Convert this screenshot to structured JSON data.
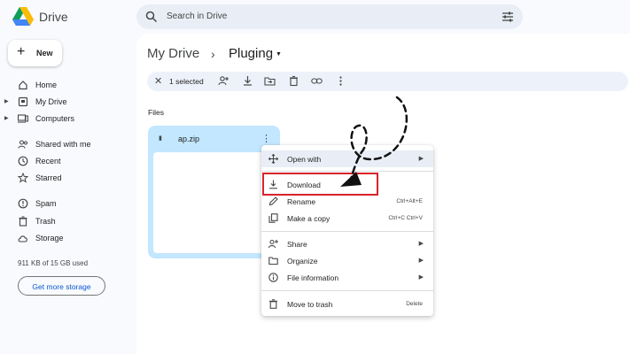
{
  "app": {
    "name": "Drive"
  },
  "search": {
    "placeholder": "Search in Drive"
  },
  "new_button": {
    "label": "New"
  },
  "sidebar": {
    "items": [
      {
        "label": "Home",
        "icon": "home-icon"
      },
      {
        "label": "My Drive",
        "icon": "my-drive-icon"
      },
      {
        "label": "Computers",
        "icon": "computers-icon"
      },
      {
        "label": "Shared with me",
        "icon": "shared-icon"
      },
      {
        "label": "Recent",
        "icon": "clock-icon"
      },
      {
        "label": "Starred",
        "icon": "star-icon"
      },
      {
        "label": "Spam",
        "icon": "spam-icon"
      },
      {
        "label": "Trash",
        "icon": "trash-icon"
      },
      {
        "label": "Storage",
        "icon": "cloud-icon"
      }
    ],
    "storage_text": "911 KB of 15 GB used",
    "storage_button": "Get more storage"
  },
  "breadcrumb": {
    "root": "My Drive",
    "separator": "›",
    "current": "Pluging"
  },
  "selection_bar": {
    "count_label": "1 selected"
  },
  "files_section": {
    "label": "Files"
  },
  "file": {
    "name": "ap.zip"
  },
  "context_menu": {
    "items": [
      {
        "label": "Open with",
        "shortcut": "",
        "submenu": true,
        "icon": "open-with-icon"
      },
      {
        "label": "Download",
        "shortcut": "",
        "submenu": false,
        "icon": "download-icon"
      },
      {
        "label": "Rename",
        "shortcut": "Ctrl+Alt+E",
        "submenu": false,
        "icon": "pencil-icon"
      },
      {
        "label": "Make a copy",
        "shortcut": "Ctrl+C Ctrl+V",
        "submenu": false,
        "icon": "copy-icon"
      },
      {
        "label": "Share",
        "shortcut": "",
        "submenu": true,
        "icon": "share-icon"
      },
      {
        "label": "Organize",
        "shortcut": "",
        "submenu": true,
        "icon": "folder-icon"
      },
      {
        "label": "File information",
        "shortcut": "",
        "submenu": true,
        "icon": "info-icon"
      },
      {
        "label": "Move to trash",
        "shortcut": "Delete",
        "submenu": false,
        "icon": "trash-icon"
      }
    ]
  },
  "colors": {
    "accent": "#0b57d0",
    "selected_file": "#c2e7ff",
    "highlight_box": "#d9222a",
    "background": "#f8fafd"
  }
}
